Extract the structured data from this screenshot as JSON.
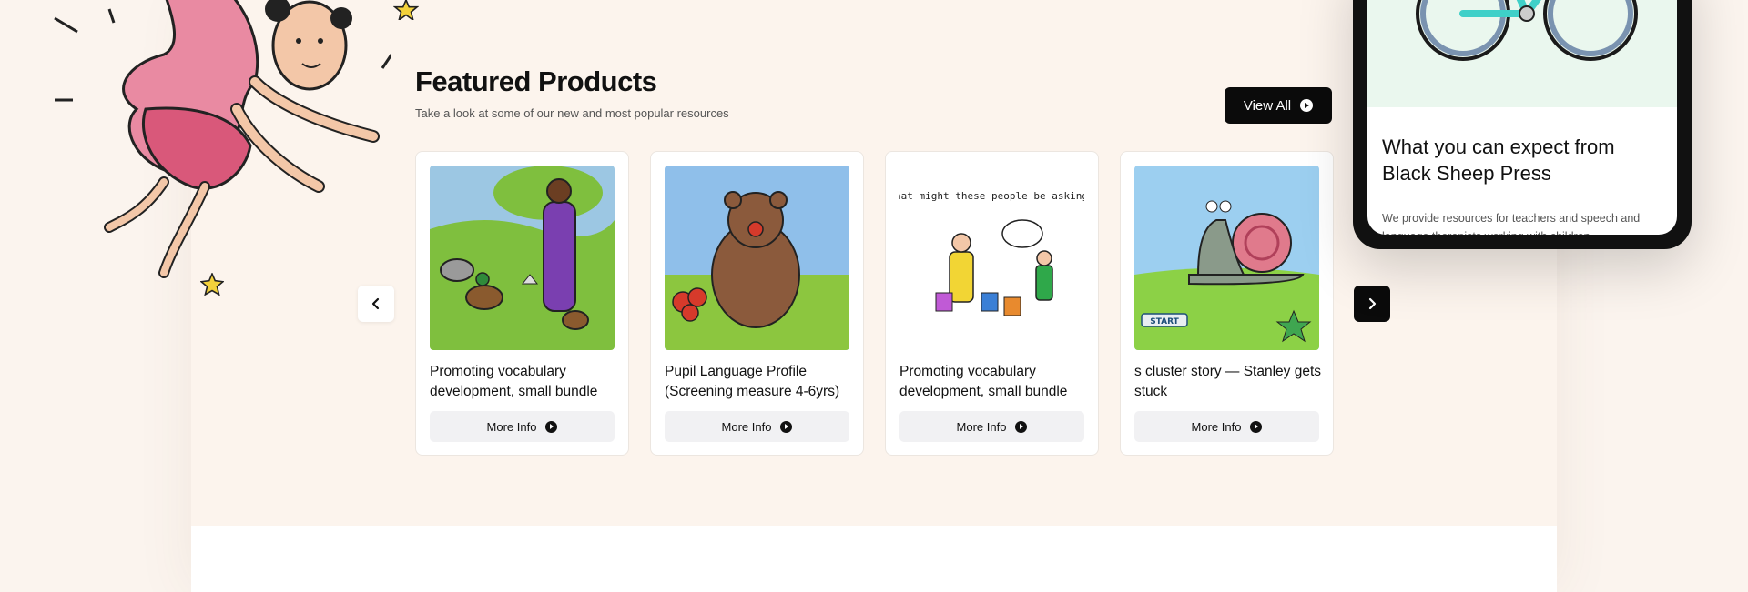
{
  "featured": {
    "title": "Featured Products",
    "subtitle": "Take a look at some of our new and most popular resources",
    "view_all_label": "View All"
  },
  "products": [
    {
      "title": "Promoting vocabulary development, small bundle",
      "more_label": "More Info"
    },
    {
      "title": "Pupil Language Profile (Screening measure 4-6yrs)",
      "more_label": "More Info"
    },
    {
      "title": "Promoting vocabulary development, small bundle",
      "more_label": "More Info",
      "image_caption": "What might these people be asking?"
    },
    {
      "title": "s cluster story — Stanley gets stuck",
      "more_label": "More Info",
      "image_sign": "START"
    }
  ],
  "phone": {
    "heading": "What you can expect from Black Sheep Press",
    "text": "We provide resources for teachers and speech and language therapists working with children"
  },
  "icons": {
    "prev": "chevron-left-icon",
    "next": "chevron-right-icon",
    "arrow": "arrow-circle-right-icon"
  },
  "colors": {
    "background": "#fcf4ed",
    "button_dark": "#0b0b0b",
    "more_info_bg": "#f1f1f3"
  }
}
